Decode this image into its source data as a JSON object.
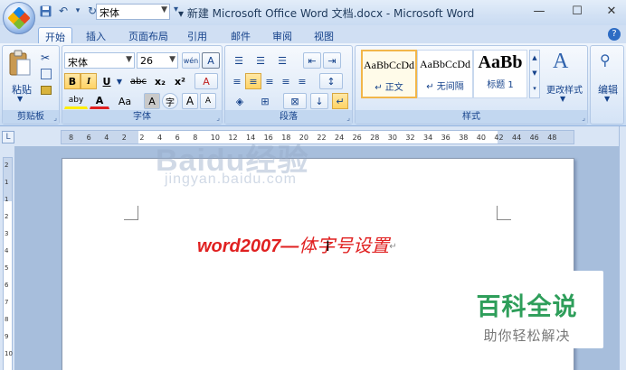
{
  "window": {
    "title": "新建 Microsoft Office Word 文档.docx - Microsoft Word",
    "controls": {
      "minimize": "—",
      "maximize": "☐",
      "close": "✕"
    },
    "modified_marker": "▾"
  },
  "qat": {
    "font_name": "宋体",
    "undo_glyph": "↶",
    "redo_glyph": "↻",
    "save_glyph": "💾",
    "more_glyph": "▾"
  },
  "tabs": [
    {
      "label": "开始",
      "active": true
    },
    {
      "label": "插入"
    },
    {
      "label": "页面布局"
    },
    {
      "label": "引用"
    },
    {
      "label": "邮件"
    },
    {
      "label": "审阅"
    },
    {
      "label": "视图"
    }
  ],
  "help_glyph": "?",
  "ribbon": {
    "clipboard": {
      "label": "剪贴板",
      "paste": "粘贴"
    },
    "font": {
      "label": "字体",
      "font_name": "宋体",
      "font_size": "26",
      "phonetic": "wén",
      "bold": "B",
      "italic": "I",
      "underline": "U",
      "strike": "abc",
      "subscript": "x₂",
      "superscript": "x²",
      "clear": "A",
      "highlight": "aby",
      "fontcolor": "A",
      "case": "Aa",
      "shade": "A",
      "enclose": "字",
      "grow": "A",
      "shrink": "A"
    },
    "paragraph": {
      "label": "段落"
    },
    "styles": {
      "label": "样式",
      "items": [
        {
          "sample": "AaBbCcDd",
          "name": "↵ 正文"
        },
        {
          "sample": "AaBbCcDd",
          "name": "↵ 无间隔"
        },
        {
          "sample": "AaBb",
          "name": "标题 1"
        }
      ],
      "change": "更改样式"
    },
    "editing": {
      "label": "编辑"
    }
  },
  "ruler": {
    "h_numbers": [
      "8",
      "6",
      "4",
      "2",
      "2",
      "4",
      "6",
      "8",
      "10",
      "12",
      "14",
      "16",
      "18",
      "20",
      "22",
      "24",
      "26",
      "28",
      "30",
      "32",
      "34",
      "36",
      "38",
      "40",
      "42",
      "44",
      "46",
      "48"
    ],
    "v_numbers": [
      "2",
      "1",
      "1",
      "2",
      "3",
      "4",
      "5",
      "6",
      "7",
      "8",
      "9",
      "10"
    ]
  },
  "document": {
    "text_en": "word2007—",
    "text_zh": "体字号设置",
    "para_mark": "↵"
  },
  "watermark": {
    "baidu": "Baidu经验",
    "jingyan": "jingyan.baidu.com",
    "badge_title": "百科全说",
    "badge_sub": "助你轻松解决"
  }
}
